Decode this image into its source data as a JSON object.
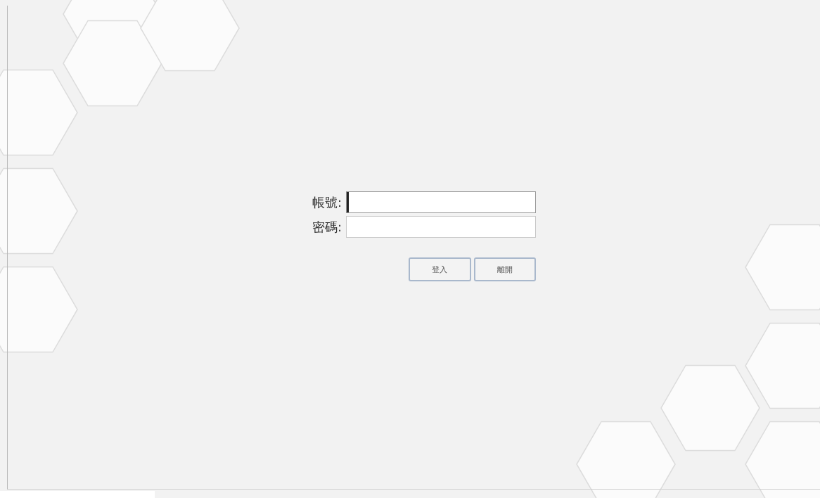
{
  "form": {
    "fields": [
      {
        "label": "帳號:",
        "focused": true
      },
      {
        "label": "密碼:",
        "focused": false
      }
    ],
    "buttons": [
      "登入",
      "離開"
    ]
  }
}
